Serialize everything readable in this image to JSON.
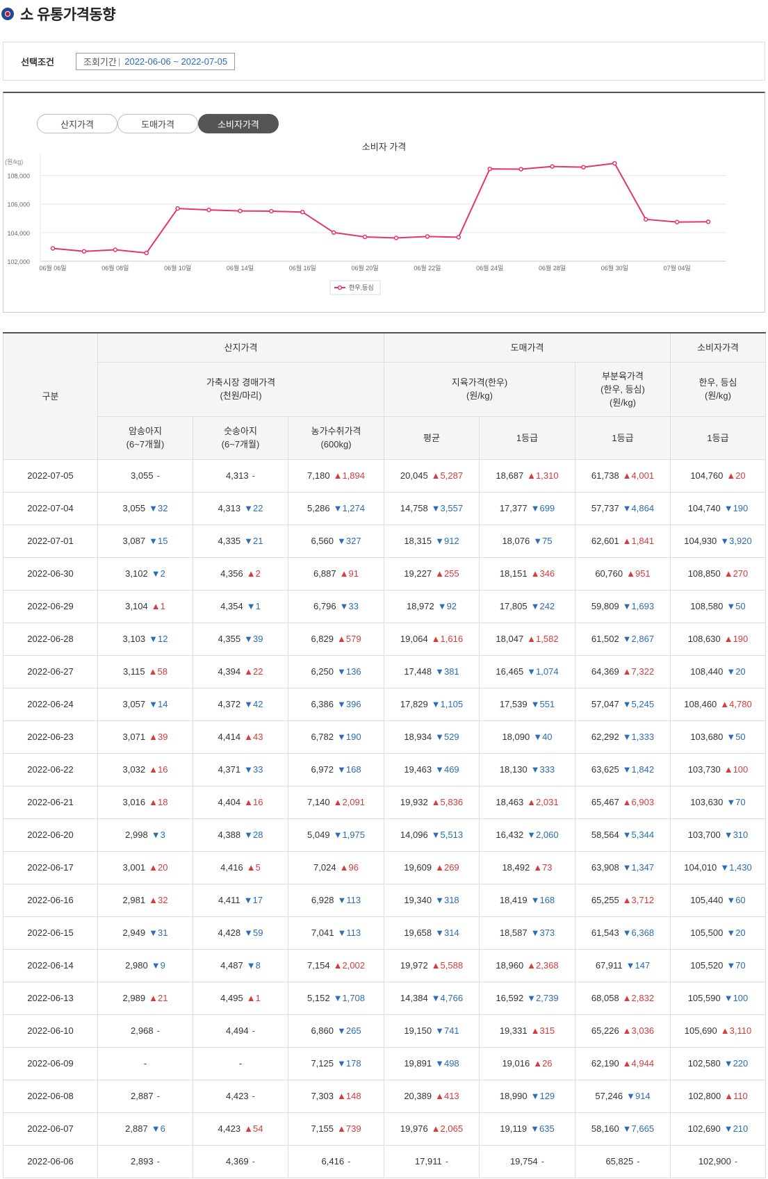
{
  "page": {
    "title": "소 유통가격동향"
  },
  "condition": {
    "label": "선택조건",
    "period_label": "조회기간",
    "period_sep": "|",
    "period_value": "2022-06-06 ~ 2022-07-05"
  },
  "tabs": [
    {
      "label": "산지가격",
      "active": false
    },
    {
      "label": "도매가격",
      "active": false
    },
    {
      "label": "소비자가격",
      "active": true
    }
  ],
  "chart_data": {
    "type": "line",
    "title": "소비자 가격",
    "ylabel": "(원/kg)",
    "ylim": [
      102000,
      109000
    ],
    "yticks": [
      "102,000",
      "104,000",
      "106,000",
      "108,000"
    ],
    "ytick_values": [
      102000,
      104000,
      106000,
      108000
    ],
    "x": [
      "06월 06일",
      "06월 07일",
      "06월 08일",
      "06월 09일",
      "06월 10일",
      "06월 13일",
      "06월 14일",
      "06월 15일",
      "06월 16일",
      "06월 17일",
      "06월 20일",
      "06월 21일",
      "06월 22일",
      "06월 23일",
      "06월 24일",
      "06월 27일",
      "06월 28일",
      "06월 29일",
      "06월 30일",
      "07월 01일",
      "07월 04일",
      "07월 05일"
    ],
    "xtick_labels": [
      "06월 06일",
      "06월 08일",
      "06월 10일",
      "06월 14일",
      "06월 16일",
      "06월 20일",
      "06월 22일",
      "06월 24일",
      "06월 28일",
      "06월 30일",
      "07월 04일"
    ],
    "grid": true,
    "legend_position": "bottom",
    "series": [
      {
        "name": "한우,등심",
        "color": "#e6336e",
        "values": [
          102900,
          102690,
          102800,
          102580,
          105690,
          105590,
          105520,
          105500,
          105440,
          104010,
          103700,
          103630,
          103730,
          103680,
          108460,
          108440,
          108630,
          108580,
          108850,
          104930,
          104740,
          104760
        ]
      }
    ]
  },
  "table": {
    "head": {
      "gubun": "구분",
      "group_sanji": "산지가격",
      "group_domae": "도매가격",
      "group_sobija": "소비자가격",
      "sub_auction": "가축시장 경매가격",
      "sub_auction_unit": "(천원/마리)",
      "sub_jiyuk": "지육가격(한우)",
      "sub_jiyuk_unit": "(원/kg)",
      "sub_bubun": "부분육가격",
      "sub_bubun_unit1": "(한우, 등심)",
      "sub_bubun_unit2": "(원/kg)",
      "sub_sobija": "한우, 등심",
      "sub_sobija_unit": "(원/kg)",
      "c_amsong": "암송아지",
      "c_amsong_unit": "(6~7개월)",
      "c_susong": "숫송아지",
      "c_susong_unit": "(6~7개월)",
      "c_nongga": "농가수취가격",
      "c_nongga_unit": "(600kg)",
      "c_avg": "평균",
      "c_grade1a": "1등급",
      "c_grade1b": "1등급",
      "c_grade1c": "1등급"
    },
    "rows": [
      {
        "date": "2022-07-05",
        "cells": [
          [
            "3,055",
            "-",
            ""
          ],
          [
            "4,313",
            "-",
            ""
          ],
          [
            "7,180",
            "▲",
            "1,894"
          ],
          [
            "20,045",
            "▲",
            "5,287"
          ],
          [
            "18,687",
            "▲",
            "1,310"
          ],
          [
            "61,738",
            "▲",
            "4,001"
          ],
          [
            "104,760",
            "▲",
            "20"
          ]
        ]
      },
      {
        "date": "2022-07-04",
        "cells": [
          [
            "3,055",
            "▼",
            "32"
          ],
          [
            "4,313",
            "▼",
            "22"
          ],
          [
            "5,286",
            "▼",
            "1,274"
          ],
          [
            "14,758",
            "▼",
            "3,557"
          ],
          [
            "17,377",
            "▼",
            "699"
          ],
          [
            "57,737",
            "▼",
            "4,864"
          ],
          [
            "104,740",
            "▼",
            "190"
          ]
        ]
      },
      {
        "date": "2022-07-01",
        "cells": [
          [
            "3,087",
            "▼",
            "15"
          ],
          [
            "4,335",
            "▼",
            "21"
          ],
          [
            "6,560",
            "▼",
            "327"
          ],
          [
            "18,315",
            "▼",
            "912"
          ],
          [
            "18,076",
            "▼",
            "75"
          ],
          [
            "62,601",
            "▲",
            "1,841"
          ],
          [
            "104,930",
            "▼",
            "3,920"
          ]
        ]
      },
      {
        "date": "2022-06-30",
        "cells": [
          [
            "3,102",
            "▼",
            "2"
          ],
          [
            "4,356",
            "▲",
            "2"
          ],
          [
            "6,887",
            "▲",
            "91"
          ],
          [
            "19,227",
            "▲",
            "255"
          ],
          [
            "18,151",
            "▲",
            "346"
          ],
          [
            "60,760",
            "▲",
            "951"
          ],
          [
            "108,850",
            "▲",
            "270"
          ]
        ]
      },
      {
        "date": "2022-06-29",
        "cells": [
          [
            "3,104",
            "▲",
            "1"
          ],
          [
            "4,354",
            "▼",
            "1"
          ],
          [
            "6,796",
            "▼",
            "33"
          ],
          [
            "18,972",
            "▼",
            "92"
          ],
          [
            "17,805",
            "▼",
            "242"
          ],
          [
            "59,809",
            "▼",
            "1,693"
          ],
          [
            "108,580",
            "▼",
            "50"
          ]
        ]
      },
      {
        "date": "2022-06-28",
        "cells": [
          [
            "3,103",
            "▼",
            "12"
          ],
          [
            "4,355",
            "▼",
            "39"
          ],
          [
            "6,829",
            "▲",
            "579"
          ],
          [
            "19,064",
            "▲",
            "1,616"
          ],
          [
            "18,047",
            "▲",
            "1,582"
          ],
          [
            "61,502",
            "▼",
            "2,867"
          ],
          [
            "108,630",
            "▲",
            "190"
          ]
        ]
      },
      {
        "date": "2022-06-27",
        "cells": [
          [
            "3,115",
            "▲",
            "58"
          ],
          [
            "4,394",
            "▲",
            "22"
          ],
          [
            "6,250",
            "▼",
            "136"
          ],
          [
            "17,448",
            "▼",
            "381"
          ],
          [
            "16,465",
            "▼",
            "1,074"
          ],
          [
            "64,369",
            "▲",
            "7,322"
          ],
          [
            "108,440",
            "▼",
            "20"
          ]
        ]
      },
      {
        "date": "2022-06-24",
        "cells": [
          [
            "3,057",
            "▼",
            "14"
          ],
          [
            "4,372",
            "▼",
            "42"
          ],
          [
            "6,386",
            "▼",
            "396"
          ],
          [
            "17,829",
            "▼",
            "1,105"
          ],
          [
            "17,539",
            "▼",
            "551"
          ],
          [
            "57,047",
            "▼",
            "5,245"
          ],
          [
            "108,460",
            "▲",
            "4,780"
          ]
        ]
      },
      {
        "date": "2022-06-23",
        "cells": [
          [
            "3,071",
            "▲",
            "39"
          ],
          [
            "4,414",
            "▲",
            "43"
          ],
          [
            "6,782",
            "▼",
            "190"
          ],
          [
            "18,934",
            "▼",
            "529"
          ],
          [
            "18,090",
            "▼",
            "40"
          ],
          [
            "62,292",
            "▼",
            "1,333"
          ],
          [
            "103,680",
            "▼",
            "50"
          ]
        ]
      },
      {
        "date": "2022-06-22",
        "cells": [
          [
            "3,032",
            "▲",
            "16"
          ],
          [
            "4,371",
            "▼",
            "33"
          ],
          [
            "6,972",
            "▼",
            "168"
          ],
          [
            "19,463",
            "▼",
            "469"
          ],
          [
            "18,130",
            "▼",
            "333"
          ],
          [
            "63,625",
            "▼",
            "1,842"
          ],
          [
            "103,730",
            "▲",
            "100"
          ]
        ]
      },
      {
        "date": "2022-06-21",
        "cells": [
          [
            "3,016",
            "▲",
            "18"
          ],
          [
            "4,404",
            "▲",
            "16"
          ],
          [
            "7,140",
            "▲",
            "2,091"
          ],
          [
            "19,932",
            "▲",
            "5,836"
          ],
          [
            "18,463",
            "▲",
            "2,031"
          ],
          [
            "65,467",
            "▲",
            "6,903"
          ],
          [
            "103,630",
            "▼",
            "70"
          ]
        ]
      },
      {
        "date": "2022-06-20",
        "cells": [
          [
            "2,998",
            "▼",
            "3"
          ],
          [
            "4,388",
            "▼",
            "28"
          ],
          [
            "5,049",
            "▼",
            "1,975"
          ],
          [
            "14,096",
            "▼",
            "5,513"
          ],
          [
            "16,432",
            "▼",
            "2,060"
          ],
          [
            "58,564",
            "▼",
            "5,344"
          ],
          [
            "103,700",
            "▼",
            "310"
          ]
        ]
      },
      {
        "date": "2022-06-17",
        "cells": [
          [
            "3,001",
            "▲",
            "20"
          ],
          [
            "4,416",
            "▲",
            "5"
          ],
          [
            "7,024",
            "▲",
            "96"
          ],
          [
            "19,609",
            "▲",
            "269"
          ],
          [
            "18,492",
            "▲",
            "73"
          ],
          [
            "63,908",
            "▼",
            "1,347"
          ],
          [
            "104,010",
            "▼",
            "1,430"
          ]
        ]
      },
      {
        "date": "2022-06-16",
        "cells": [
          [
            "2,981",
            "▲",
            "32"
          ],
          [
            "4,411",
            "▼",
            "17"
          ],
          [
            "6,928",
            "▼",
            "113"
          ],
          [
            "19,340",
            "▼",
            "318"
          ],
          [
            "18,419",
            "▼",
            "168"
          ],
          [
            "65,255",
            "▲",
            "3,712"
          ],
          [
            "105,440",
            "▼",
            "60"
          ]
        ]
      },
      {
        "date": "2022-06-15",
        "cells": [
          [
            "2,949",
            "▼",
            "31"
          ],
          [
            "4,428",
            "▼",
            "59"
          ],
          [
            "7,041",
            "▼",
            "113"
          ],
          [
            "19,658",
            "▼",
            "314"
          ],
          [
            "18,587",
            "▼",
            "373"
          ],
          [
            "61,543",
            "▼",
            "6,368"
          ],
          [
            "105,500",
            "▼",
            "20"
          ]
        ]
      },
      {
        "date": "2022-06-14",
        "cells": [
          [
            "2,980",
            "▼",
            "9"
          ],
          [
            "4,487",
            "▼",
            "8"
          ],
          [
            "7,154",
            "▲",
            "2,002"
          ],
          [
            "19,972",
            "▲",
            "5,588"
          ],
          [
            "18,960",
            "▲",
            "2,368"
          ],
          [
            "67,911",
            "▼",
            "147"
          ],
          [
            "105,520",
            "▼",
            "70"
          ]
        ]
      },
      {
        "date": "2022-06-13",
        "cells": [
          [
            "2,989",
            "▲",
            "21"
          ],
          [
            "4,495",
            "▲",
            "1"
          ],
          [
            "5,152",
            "▼",
            "1,708"
          ],
          [
            "14,384",
            "▼",
            "4,766"
          ],
          [
            "16,592",
            "▼",
            "2,739"
          ],
          [
            "68,058",
            "▲",
            "2,832"
          ],
          [
            "105,590",
            "▼",
            "100"
          ]
        ]
      },
      {
        "date": "2022-06-10",
        "cells": [
          [
            "2,968",
            "-",
            ""
          ],
          [
            "4,494",
            "-",
            ""
          ],
          [
            "6,860",
            "▼",
            "265"
          ],
          [
            "19,150",
            "▼",
            "741"
          ],
          [
            "19,331",
            "▲",
            "315"
          ],
          [
            "65,226",
            "▲",
            "3,036"
          ],
          [
            "105,690",
            "▲",
            "3,110"
          ]
        ]
      },
      {
        "date": "2022-06-09",
        "cells": [
          [
            "-",
            "",
            ""
          ],
          [
            "-",
            "",
            ""
          ],
          [
            "7,125",
            "▼",
            "178"
          ],
          [
            "19,891",
            "▼",
            "498"
          ],
          [
            "19,016",
            "▲",
            "26"
          ],
          [
            "62,190",
            "▲",
            "4,944"
          ],
          [
            "102,580",
            "▼",
            "220"
          ]
        ]
      },
      {
        "date": "2022-06-08",
        "cells": [
          [
            "2,887",
            "-",
            ""
          ],
          [
            "4,423",
            "-",
            ""
          ],
          [
            "7,303",
            "▲",
            "148"
          ],
          [
            "20,389",
            "▲",
            "413"
          ],
          [
            "18,990",
            "▼",
            "129"
          ],
          [
            "57,246",
            "▼",
            "914"
          ],
          [
            "102,800",
            "▲",
            "110"
          ]
        ]
      },
      {
        "date": "2022-06-07",
        "cells": [
          [
            "2,887",
            "▼",
            "6"
          ],
          [
            "4,423",
            "▲",
            "54"
          ],
          [
            "7,155",
            "▲",
            "739"
          ],
          [
            "19,976",
            "▲",
            "2,065"
          ],
          [
            "19,119",
            "▼",
            "635"
          ],
          [
            "58,160",
            "▼",
            "7,665"
          ],
          [
            "102,690",
            "▼",
            "210"
          ]
        ]
      },
      {
        "date": "2022-06-06",
        "cells": [
          [
            "2,893",
            "-",
            ""
          ],
          [
            "4,369",
            "-",
            ""
          ],
          [
            "6,416",
            "-",
            ""
          ],
          [
            "17,911",
            "-",
            ""
          ],
          [
            "19,754",
            "-",
            ""
          ],
          [
            "65,825",
            "-",
            ""
          ],
          [
            "102,900",
            "-",
            ""
          ]
        ]
      }
    ]
  }
}
